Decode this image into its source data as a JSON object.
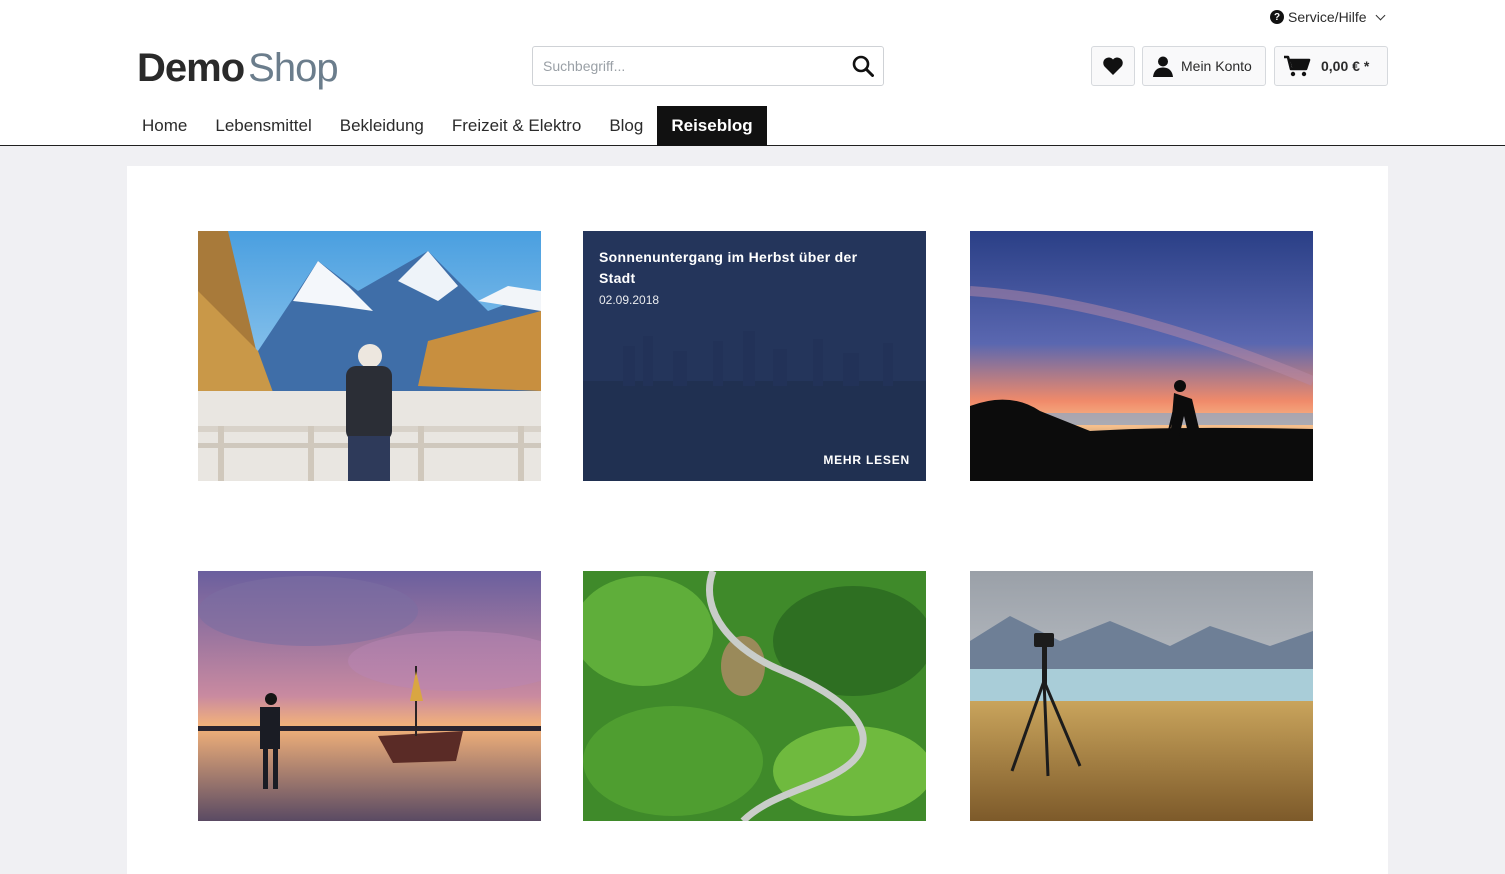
{
  "header": {
    "service_label": "Service/Hilfe",
    "logo": {
      "part1": "Demo",
      "part2": "Shop"
    },
    "search": {
      "placeholder": "Suchbegriff..."
    },
    "account_label": "Mein Konto",
    "cart_total": "0,00 € *"
  },
  "nav": {
    "items": [
      {
        "label": "Home"
      },
      {
        "label": "Lebensmittel"
      },
      {
        "label": "Bekleidung"
      },
      {
        "label": "Freizeit & Elektro"
      },
      {
        "label": "Blog"
      },
      {
        "label": "Reiseblog",
        "active": true
      }
    ]
  },
  "blog": {
    "featured": {
      "title": "Sonnenuntergang im Herbst über der Stadt",
      "date": "02.09.2018",
      "more_label": "MEHR LESEN"
    },
    "tiles": [
      {
        "image": "mountain-hiker-photo"
      },
      {
        "image": "city-sunset-photo"
      },
      {
        "image": "photographer-silhouette-photo"
      },
      {
        "image": "boat-sunset-photo"
      },
      {
        "image": "forest-road-aerial-photo"
      },
      {
        "image": "camera-tripod-lake-photo"
      }
    ]
  },
  "colors": {
    "nav_active_bg": "#111111",
    "overlay": "#1c2c54",
    "page_bg": "#f0f0f3"
  }
}
